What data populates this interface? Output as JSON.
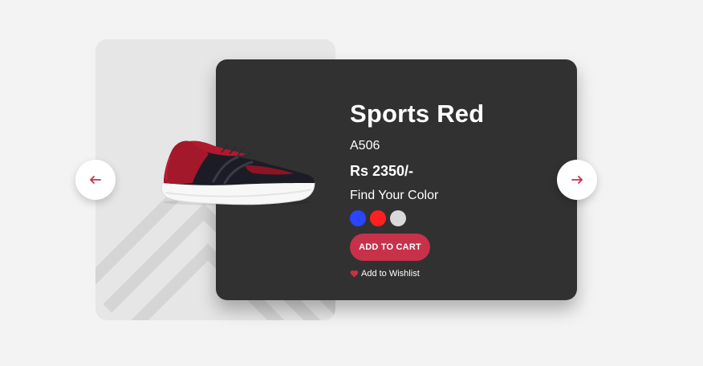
{
  "product": {
    "name": "Sports Red",
    "code": "A506",
    "price": "Rs 2350/-",
    "color_label": "Find Your Color",
    "colors": [
      "#2b45ff",
      "#ff2020",
      "#d9d9d9"
    ],
    "add_to_cart": "ADD TO CART",
    "wishlist": "Add to Wishlist"
  },
  "icons": {
    "prev": "arrow-left-icon",
    "next": "arrow-right-icon",
    "wishlist": "heart-icon"
  },
  "accent_color": "#c7314a",
  "card_color": "#313131"
}
